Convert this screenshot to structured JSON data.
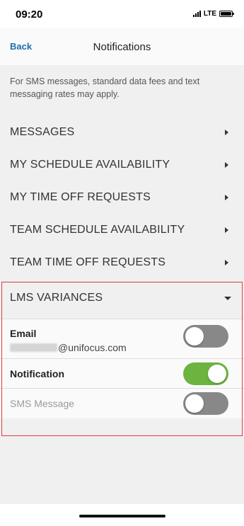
{
  "status_bar": {
    "time": "09:20",
    "network": "LTE"
  },
  "nav": {
    "back_label": "Back",
    "title": "Notifications"
  },
  "notice": "For SMS messages, standard data fees and text messaging rates may apply.",
  "rows": [
    {
      "label": "MESSAGES"
    },
    {
      "label": "MY SCHEDULE AVAILABILITY"
    },
    {
      "label": "MY TIME OFF REQUESTS"
    },
    {
      "label": "TEAM SCHEDULE AVAILABILITY"
    },
    {
      "label": "TEAM TIME OFF REQUESTS"
    }
  ],
  "expanded": {
    "label": "LMS VARIANCES",
    "email": {
      "label": "Email",
      "value_suffix": "@unifocus.com",
      "on": false
    },
    "notification": {
      "label": "Notification",
      "on": true
    },
    "sms": {
      "label": "SMS Message",
      "on": false
    }
  },
  "colors": {
    "accent": "#1a6fb0",
    "toggle_on": "#6db33f",
    "toggle_off": "#888888",
    "highlight": "#e33b3b"
  }
}
